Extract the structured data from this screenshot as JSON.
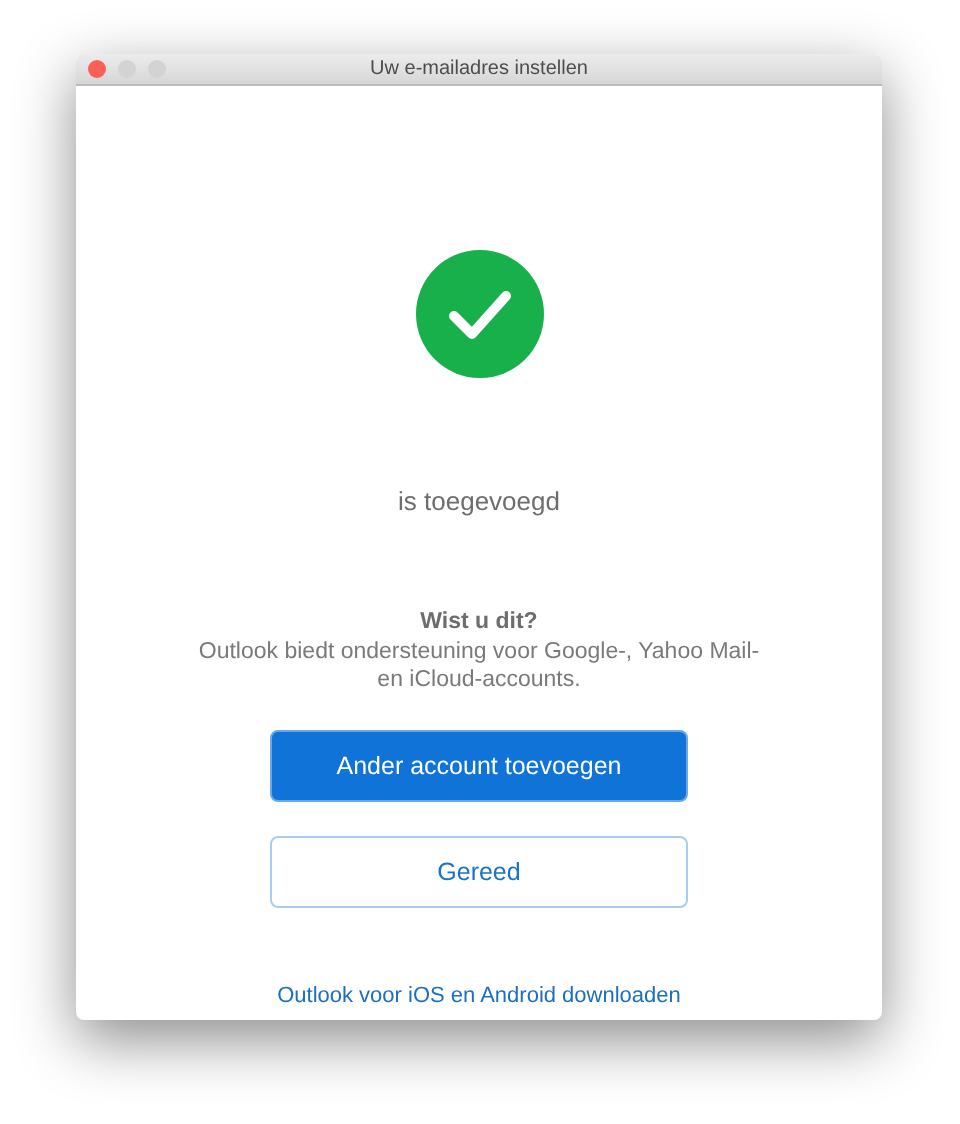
{
  "window": {
    "title": "Uw e-mailadres instellen"
  },
  "status": "is toegevoegd",
  "tip": {
    "heading": "Wist u dit?",
    "text": "Outlook biedt ondersteuning voor Google-, Yahoo Mail- en iCloud-accounts."
  },
  "buttons": [
    {
      "label": "Ander account toevoegen",
      "kind": "primary"
    },
    {
      "label": "Gereed",
      "kind": "outline"
    }
  ],
  "link": "Outlook voor iOS en Android downloaden"
}
